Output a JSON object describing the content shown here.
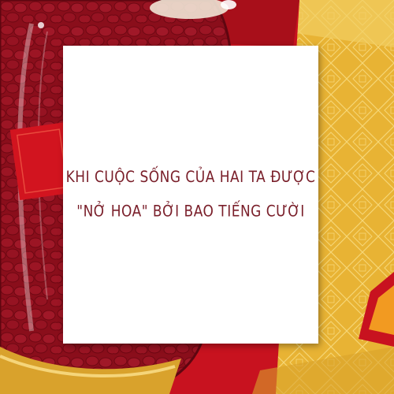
{
  "card": {
    "line1": "KHI CUỘC SỐNG CỦA HAI TA ĐƯỢC",
    "line2": "\"NỞ HOA\" BỞI BAO TIẾNG CƯỜI"
  },
  "colors": {
    "text": "#7a1f2a",
    "card": "#ffffff",
    "gold_background": "#e9b232",
    "jar_red": "#8e0f1c",
    "red_envelope": "#c8121f"
  }
}
